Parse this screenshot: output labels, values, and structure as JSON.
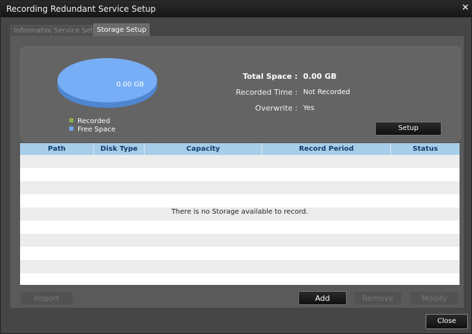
{
  "window": {
    "title": "Recording Redundant Service Setup"
  },
  "tabs": [
    {
      "label": "Information"
    },
    {
      "label": "Service Setup"
    },
    {
      "label": "Storage Setup"
    }
  ],
  "summary": {
    "pie_label": "0.00 GB",
    "legend": [
      {
        "label": "Recorded",
        "color": "#8ab04a"
      },
      {
        "label": "Free Space",
        "color": "#6ea8f0"
      }
    ],
    "total_space": {
      "label": "Total Space :",
      "value": "0.00 GB"
    },
    "recorded_time": {
      "label": "Recorded Time :",
      "value": "Not Recorded"
    },
    "overwrite": {
      "label": "Overwrite :",
      "value": "Yes"
    },
    "setup_button": "Setup"
  },
  "table": {
    "columns": [
      "Path",
      "Disk Type",
      "Capacity",
      "Record Period",
      "Status"
    ],
    "rows": [],
    "empty_message": "There is no Storage available to record."
  },
  "actions": {
    "import": "Import",
    "add": "Add",
    "remove": "Remove",
    "modify": "Modify"
  },
  "footer": {
    "close": "Close"
  }
}
